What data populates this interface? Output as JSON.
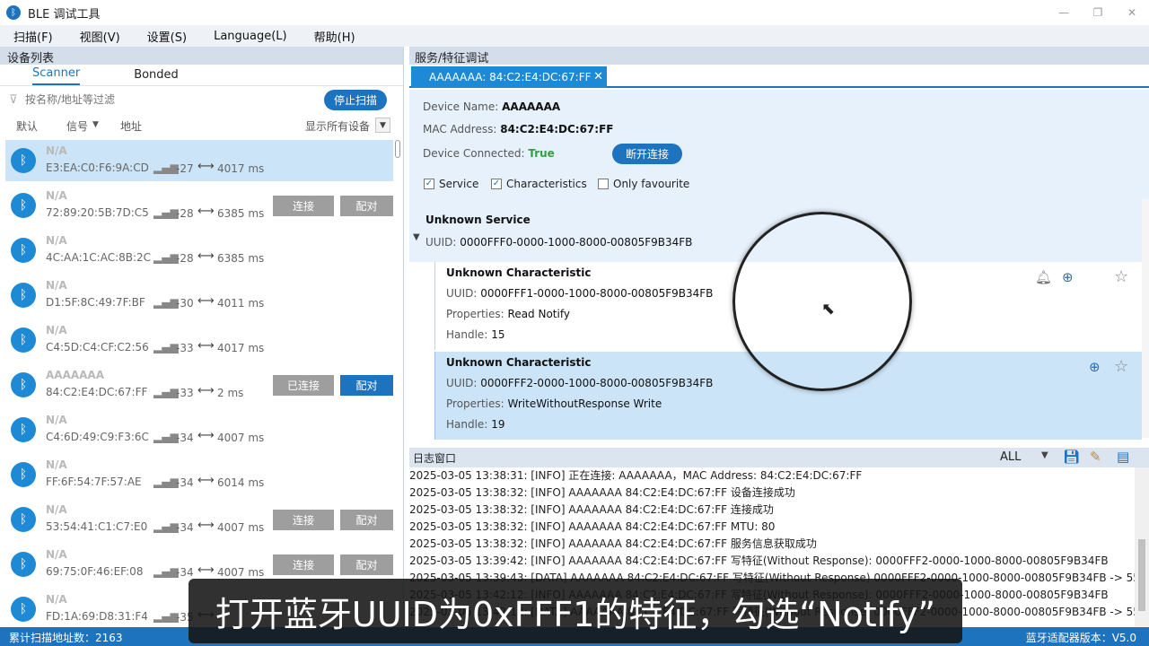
{
  "window": {
    "title": "BLE 调试工具",
    "icon": "bluetooth-icon"
  },
  "menu": [
    "扫描(F)",
    "视图(V)",
    "设置(S)",
    "Language(L)",
    "帮助(H)"
  ],
  "left": {
    "header": "设备列表",
    "tabs": [
      "Scanner",
      "Bonded"
    ],
    "filter_placeholder": "按名称/地址等过滤",
    "stop_label": "停止扫描",
    "sort": {
      "default": "默认",
      "signal": "信号",
      "address": "地址",
      "show_all": "显示所有设备"
    },
    "devices": [
      {
        "name": "N/A",
        "mac": "E3:EA:C0:F6:9A:CD",
        "rssi": "-27",
        "interval": "4017 ms",
        "selected": true
      },
      {
        "name": "N/A",
        "mac": "72:89:20:5B:7D:C5",
        "rssi": "-28",
        "interval": "6385 ms",
        "connect": "连接",
        "pair": "配对"
      },
      {
        "name": "N/A",
        "mac": "4C:AA:1C:AC:8B:2C",
        "rssi": "-28",
        "interval": "6385 ms"
      },
      {
        "name": "N/A",
        "mac": "D1:5F:8C:49:7F:BF",
        "rssi": "-30",
        "interval": "4011 ms"
      },
      {
        "name": "N/A",
        "mac": "C4:5D:C4:CF:C2:56",
        "rssi": "-33",
        "interval": "4017 ms"
      },
      {
        "name": "AAAAAAA",
        "mac": "84:C2:E4:DC:67:FF",
        "rssi": "-33",
        "interval": "2 ms",
        "connect": "已连接",
        "pair": "配对"
      },
      {
        "name": "N/A",
        "mac": "C4:6D:49:C9:F3:6C",
        "rssi": "-34",
        "interval": "4007 ms"
      },
      {
        "name": "N/A",
        "mac": "FF:6F:54:7F:57:AE",
        "rssi": "-34",
        "interval": "6014 ms"
      },
      {
        "name": "N/A",
        "mac": "53:54:41:C1:C7:E0",
        "rssi": "-34",
        "interval": "4007 ms",
        "connect": "连接",
        "pair": "配对"
      },
      {
        "name": "N/A",
        "mac": "69:75:0F:46:EF:08",
        "rssi": "-34",
        "interval": "4007 ms",
        "connect": "连接",
        "pair": "配对"
      },
      {
        "name": "N/A",
        "mac": "FD:1A:69:D8:31:F4",
        "rssi": "-35",
        "interval": ""
      }
    ]
  },
  "right": {
    "header": "服务/特征调试",
    "tab_label": "AAAAAAA: 84:C2:E4:DC:67:FF",
    "device_name_label": "Device Name:",
    "device_name": "AAAAAAA",
    "mac_label": "MAC Address:",
    "mac": "84:C2:E4:DC:67:FF",
    "connected_label": "Device Connected:",
    "connected": "True",
    "disconnect_label": "断开连接",
    "checkboxes": [
      "Service",
      "Characteristics",
      "Only favourite"
    ],
    "service": {
      "title": "Unknown Service",
      "uuid_label": "UUID:",
      "uuid": "0000FFF0-0000-1000-8000-00805F9B34FB"
    },
    "characteristics": [
      {
        "title": "Unknown Characteristic",
        "uuid_label": "UUID:",
        "uuid": "0000FFF1-0000-1000-8000-00805F9B34FB",
        "props_label": "Properties:",
        "props": "Read Notify",
        "handle_label": "Handle:",
        "handle": "15"
      },
      {
        "title": "Unknown Characteristic",
        "uuid_label": "UUID:",
        "uuid": "0000FFF2-0000-1000-8000-00805F9B34FB",
        "props_label": "Properties:",
        "props": "WriteWithoutResponse Write",
        "handle_label": "Handle:",
        "handle": "19"
      }
    ]
  },
  "log": {
    "header": "日志窗口",
    "filter": "ALL",
    "lines": [
      "2025-03-05 13:38:31: [INFO] 正在连接: AAAAAAA，MAC Address: 84:C2:E4:DC:67:FF",
      "2025-03-05 13:38:32: [INFO] AAAAAAA 84:C2:E4:DC:67:FF 设备连接成功",
      "2025-03-05 13:38:32: [INFO] AAAAAAA 84:C2:E4:DC:67:FF 连接成功",
      "2025-03-05 13:38:32: [INFO] AAAAAAA 84:C2:E4:DC:67:FF MTU: 80",
      "2025-03-05 13:38:32: [INFO] AAAAAAA 84:C2:E4:DC:67:FF 服务信息获取成功",
      "2025-03-05 13:39:42: [INFO] AAAAAAA 84:C2:E4:DC:67:FF 写特征(Without Response): 0000FFF2-0000-1000-8000-00805F9B34FB",
      "2025-03-05 13:39:43: [DATA] AAAAAAA 84:C2:E4:DC:67:FF 写特征(Without Response) 0000FFF2-0000-1000-8000-00805F9B34FB -> 55 55",
      "2025-03-05 13:42:12: [INFO] AAAAAAA 84:C2:E4:DC:67:FF 写特征(Without Response): 0000FFF2-0000-1000-8000-00805F9B34FB",
      "2025-03-05 13:42:12: [DATA] AAAAAAA 84:C2:E4:DC:67:FF 写特征(Without Response) 0000FFF2-0000-1000-8000-00805F9B34FB -> 55 55"
    ]
  },
  "status": {
    "left": "累计扫描地址数：2163",
    "right": "蓝牙适配器版本：V5.0"
  },
  "subtitle": "打开蓝牙UUID为0xFFF1的特征，勾选“Notify”"
}
